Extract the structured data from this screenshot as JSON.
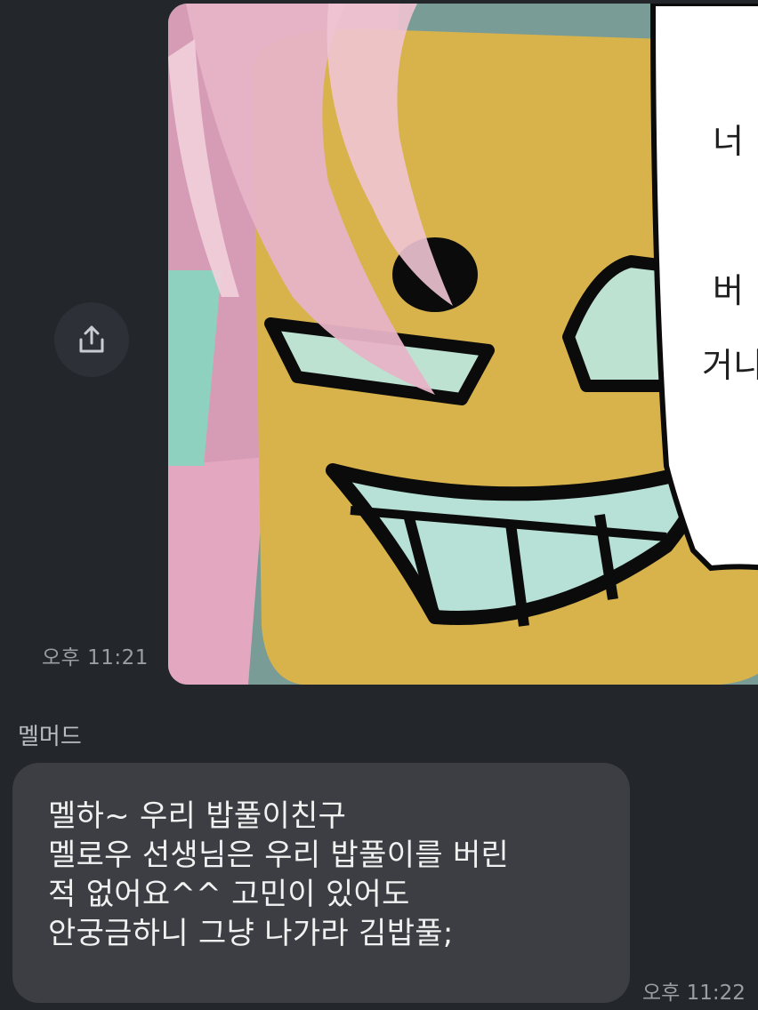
{
  "messages": {
    "sent_image": {
      "time": "오후 11:21",
      "speech_bubble_lines": [
        "너",
        "",
        "버",
        "거니"
      ]
    },
    "received": {
      "sender": "멜머드",
      "lines": [
        "멜하~ 우리 밥풀이친구",
        "멜로우 선생님은 우리 밥풀이를 버린",
        "적 없어요^^ 고민이 있어도",
        "안궁금하니 그냥 나가라 김밥풀;"
      ],
      "time": "오후 11:22"
    }
  },
  "icons": {
    "share": "share-upload-icon"
  },
  "colors": {
    "background": "#23262b",
    "bubble": "#3c3e43",
    "timestamp": "#9a9da3"
  }
}
